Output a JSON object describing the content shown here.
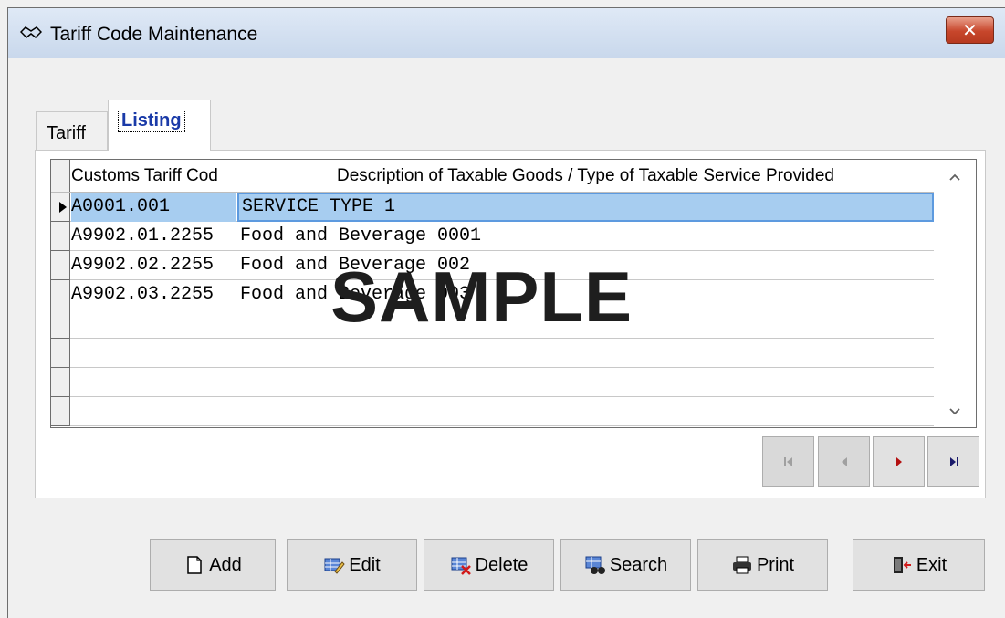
{
  "window": {
    "title": "Tariff Code Maintenance",
    "close_label": "✕"
  },
  "tabs": [
    {
      "label": "Tariff",
      "active": false
    },
    {
      "label": "Listing",
      "active": true
    }
  ],
  "grid": {
    "columns": [
      "Customs Tariff Cod",
      "Description of Taxable Goods / Type of Taxable Service Provided"
    ],
    "rows": [
      {
        "code": "A0001.001",
        "description": "SERVICE TYPE 1",
        "selected": true
      },
      {
        "code": "A9902.01.2255",
        "description": "Food and Beverage 0001",
        "selected": false
      },
      {
        "code": "A9902.02.2255",
        "description": "Food and Beverage 002",
        "selected": false
      },
      {
        "code": "A9902.03.2255",
        "description": "Food and Beverage 003",
        "selected": false
      },
      {
        "code": "",
        "description": "",
        "selected": false
      },
      {
        "code": "",
        "description": "",
        "selected": false
      },
      {
        "code": "",
        "description": "",
        "selected": false
      },
      {
        "code": "",
        "description": "",
        "selected": false
      }
    ],
    "scroll_up": "^",
    "scroll_down": "v"
  },
  "navigator": {
    "first": "|◄",
    "prev": "◄",
    "next": "►",
    "last": "►|"
  },
  "buttons": {
    "add": "Add",
    "edit": "Edit",
    "delete": "Delete",
    "search": "Search",
    "print": "Print",
    "exit": "Exit"
  },
  "watermark": "SAMPLE",
  "colors": {
    "selection": "#a7cdf0",
    "tab_active_text": "#1a3aa8",
    "close_button": "#c7462b"
  }
}
